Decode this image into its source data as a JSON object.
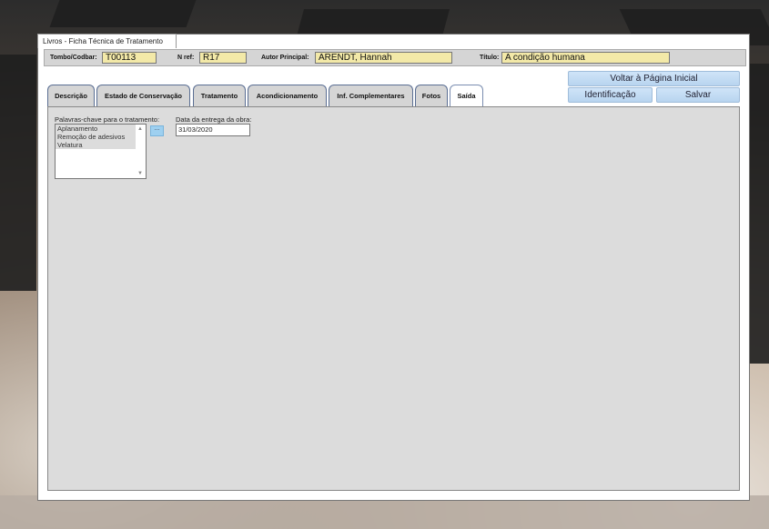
{
  "window": {
    "title": "Livros - Ficha Técnica de Tratamento"
  },
  "header": {
    "tombo_label": "Tombo/Codbar:",
    "tombo_value": "T00113",
    "nref_label": "N ref:",
    "nref_value": "R17",
    "autor_label": "Autor Principal:",
    "autor_value": "ARENDT, Hannah",
    "titulo_label": "Título:",
    "titulo_value": "A condição humana"
  },
  "buttons": {
    "home": "Voltar à Página Inicial",
    "identificacao": "Identificação",
    "salvar": "Salvar"
  },
  "tabs": [
    {
      "label": "Descrição"
    },
    {
      "label": "Estado de Conservação"
    },
    {
      "label": "Tratamento"
    },
    {
      "label": "Acondicionamento"
    },
    {
      "label": "Inf. Complementares"
    },
    {
      "label": "Fotos"
    },
    {
      "label": "Saída",
      "active": true
    }
  ],
  "form": {
    "keywords_label": "Palavras-chave para o tratamento:",
    "keywords": [
      "Aplanamento",
      "Remoção de adesivos",
      "Velatura"
    ],
    "lookup_button": "...",
    "date_label": "Data da entrega da obra:",
    "date_value": "31/03/2020"
  }
}
